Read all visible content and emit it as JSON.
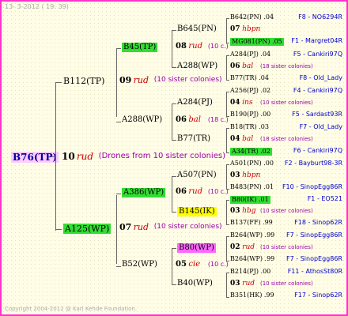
{
  "header": {
    "date": "13-  3-2012 ( 19: 39)"
  },
  "footer": {
    "copyright": "Copyright 2004-2012 @ Karl Kehde Foundation."
  },
  "colors": {
    "frame": "#ff33cc",
    "background": "#fffde6",
    "green_hl": "#33dd33",
    "yellow_hl": "#ffff00",
    "magenta_hl": "#ff66ff",
    "blue_text": "#0000cc",
    "purple_text": "#9900aa",
    "red_text": "#cc0000"
  },
  "root": {
    "label": "B76(TP)",
    "num": "10",
    "race": "rud",
    "note": "(Drones from 10 sister colonies)"
  },
  "gen1": [
    {
      "label": "B112(TP)",
      "num": "09",
      "race": "rud",
      "note": "(10 sister colonies)"
    },
    {
      "label": "A125(WP)",
      "num": "07",
      "race": "rud",
      "note": "(10 sister colonies)"
    }
  ],
  "gen2": [
    {
      "label": "B45(TP)",
      "num": "08",
      "race": "rud",
      "note": "(10 c.)"
    },
    {
      "label": "A288(WP)",
      "num": "06",
      "race": "bal",
      "note": "(18 c.)"
    },
    {
      "label": "A386(WP)",
      "num": "06",
      "race": "rud",
      "note": "(10 c.)"
    },
    {
      "label": "B52(WP)",
      "num": "05",
      "race": "cie",
      "note": "(10 c.)"
    }
  ],
  "gen3": [
    {
      "label": "B645(PN)"
    },
    {
      "label": "A288(WP)"
    },
    {
      "label": "A284(PJ)"
    },
    {
      "label": "B77(TR)"
    },
    {
      "label": "A507(PN)"
    },
    {
      "label": "B145(IK)"
    },
    {
      "label": "B80(WP)"
    },
    {
      "label": "B40(WP)"
    }
  ],
  "gen4": [
    {
      "row1": "B642(PN) .04",
      "row1b": "F8 - NO6294R",
      "mid_num": "07",
      "mid_race": "hbpn",
      "mid_note": "",
      "row2": "MG081(PN) .05",
      "row2b": "F1 - Margret04R"
    },
    {
      "row1": "A284(PJ) .04",
      "row1b": "F5 - Cankiri97Q",
      "mid_num": "06",
      "mid_race": "bal",
      "mid_note": "(18 sister colonies)",
      "row2": "B77(TR) .04",
      "row2b": "F8 - Old_Lady"
    },
    {
      "row1": "A256(PJ) .02",
      "row1b": "F4 - Cankiri97Q",
      "mid_num": "04",
      "mid_race": "ins",
      "mid_note": "(10 sister colonies)",
      "row2": "B190(PJ) .00",
      "row2b": "F5 - Sardast93R"
    },
    {
      "row1": "B18(TR) .03",
      "row1b": "F7 - Old_Lady",
      "mid_num": "04",
      "mid_race": "bal",
      "mid_note": "(18 sister colonies)",
      "row2": "A34(TR) .02",
      "row2b": "F6 - Cankiri97Q"
    },
    {
      "row1": "A501(PN) .00",
      "row1b": "F2 - Bayburt98-3R",
      "mid_num": "03",
      "mid_race": "hbpn",
      "mid_note": "",
      "row2": "B483(PN) .01",
      "row2b": "F10 - SinopEgg86R"
    },
    {
      "row1": "B80(IK) .01",
      "row1b": "F1 - EO521",
      "mid_num": "03",
      "mid_race": "hbg",
      "mid_note": "(10 sister colonies)",
      "row2": "B137(FF) .99",
      "row2b": "F18 - Sinop62R"
    },
    {
      "row1": "B264(WP) .99",
      "row1b": "F7 - SinopEgg86R",
      "mid_num": "02",
      "mid_race": "rud",
      "mid_note": "(10 sister colonies)",
      "row2": "B264(WP) .99",
      "row2b": "F7 - SinopEgg86R"
    },
    {
      "row1": "B214(PJ) .00",
      "row1b": "F11 - AthosSt80R",
      "mid_num": "03",
      "mid_race": "rud",
      "mid_note": "(10 sister colonies)",
      "row2": "B351(HK) .99",
      "row2b": "F17 - Sinop62R"
    }
  ]
}
